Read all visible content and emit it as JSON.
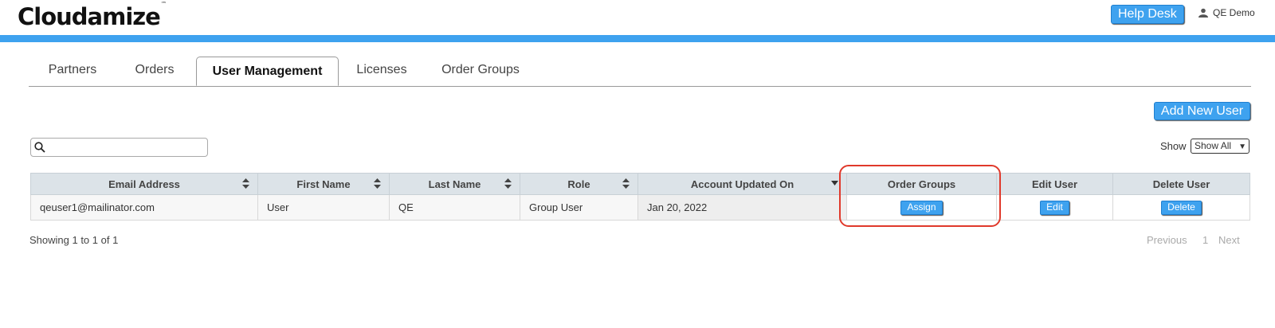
{
  "header": {
    "logo_text": "Cloudamize",
    "logo_tm": "™",
    "help_label": "Help Desk",
    "user_name": "QE Demo"
  },
  "colors": {
    "accent": "#3ea2ef",
    "highlight": "#e0392b",
    "header_bg": "#dce3e8"
  },
  "tabs": [
    {
      "label": "Partners",
      "active": false
    },
    {
      "label": "Orders",
      "active": false
    },
    {
      "label": "User Management",
      "active": true
    },
    {
      "label": "Licenses",
      "active": false
    },
    {
      "label": "Order Groups",
      "active": false
    }
  ],
  "toolbar": {
    "add_user_label": "Add New User",
    "search_placeholder": "",
    "show_label": "Show",
    "show_value": "Show All"
  },
  "table": {
    "columns": [
      "Email Address",
      "First Name",
      "Last Name",
      "Role",
      "Account Updated On",
      "Order Groups",
      "Edit User",
      "Delete User"
    ],
    "rows": [
      {
        "email": "qeuser1@mailinator.com",
        "first_name": "User",
        "last_name": "QE",
        "role": "Group User",
        "updated_on": "Jan 20, 2022",
        "assign_label": "Assign",
        "edit_label": "Edit",
        "delete_label": "Delete"
      }
    ]
  },
  "footer": {
    "info": "Showing 1 to 1 of 1",
    "previous": "Previous",
    "page": "1",
    "next": "Next"
  }
}
